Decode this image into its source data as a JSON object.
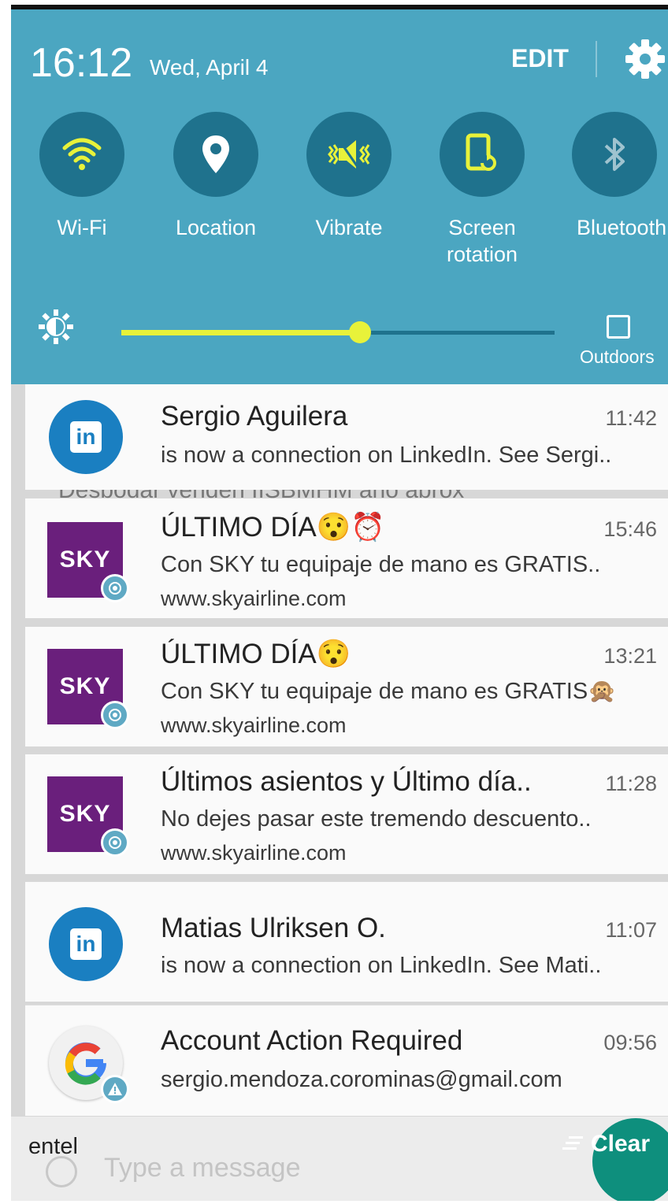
{
  "status": {
    "time": "16:12",
    "date": "Wed, April 4",
    "edit_label": "EDIT"
  },
  "quick_settings": {
    "tiles": [
      {
        "label": "Wi-Fi",
        "icon": "wifi-icon",
        "active": true
      },
      {
        "label": "Location",
        "icon": "location-icon",
        "active": false
      },
      {
        "label": "Vibrate",
        "icon": "vibrate-icon",
        "active": true
      },
      {
        "label": "Screen\nrotation",
        "icon": "screen-rotation-icon",
        "active": true
      },
      {
        "label": "Bluetooth",
        "icon": "bluetooth-icon",
        "active": false
      }
    ],
    "brightness_level": 0.55,
    "outdoors_label": "Outdoors"
  },
  "notifications": [
    {
      "app": "LinkedIn",
      "title": "Sergio Aguilera",
      "time": "11:42",
      "body": "is now a connection on LinkedIn. See Sergi.."
    },
    {
      "app": "SKY",
      "title": "ÚLTIMO DÍA😯⏰",
      "time": "15:46",
      "body": "Con SKY tu equipaje de mano es GRATIS..",
      "sub": "www.skyairline.com"
    },
    {
      "app": "SKY",
      "title": "ÚLTIMO DÍA😯",
      "time": "13:21",
      "body": "Con SKY tu equipaje de mano es GRATIS🙊",
      "sub": "www.skyairline.com"
    },
    {
      "app": "SKY",
      "title": "Últimos asientos y Último día..",
      "time": "11:28",
      "body": "No dejes pasar este tremendo descuento..",
      "sub": "www.skyairline.com"
    },
    {
      "app": "LinkedIn",
      "title": "Matias Ulriksen O.",
      "time": "11:07",
      "body": "is now a connection on LinkedIn. See Mati.."
    },
    {
      "app": "Google",
      "title": "Account Action Required",
      "time": "09:56",
      "body": "sergio.mendoza.corominas@gmail.com"
    }
  ],
  "sky_logo": "SKY",
  "linkedin_logo": "in",
  "bottom": {
    "carrier": "entel",
    "clear_label": "Clear",
    "message_placeholder": "Type a message"
  },
  "colors": {
    "panel": "#4ba6c1",
    "tile_circle": "#1f728d",
    "accent": "#e8f23a",
    "sky_purple": "#6a1f7c",
    "linkedin_blue": "#1a7fc1"
  }
}
